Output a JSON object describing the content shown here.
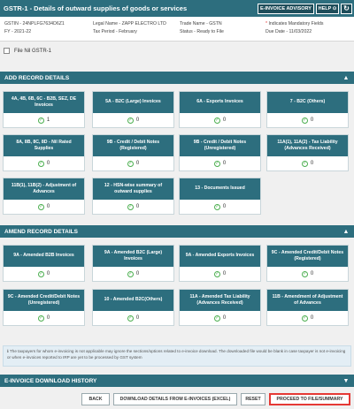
{
  "header": {
    "title": "GSTR-1 - Details of outward supplies of goods or services",
    "einvoice_label": "E-INVOICE ADVISORY",
    "help_label": "HELP ⊙",
    "refresh_label": "↻"
  },
  "info": {
    "gstin": "GSTIN - 24NPLFG7634D6Z1",
    "fy": "FY - 2021-22",
    "legal_name": "Legal Name - ZAPP ELECTRO LTD",
    "tax_period": "Tax Period - February",
    "trade_name": "Trade Name - GSTN",
    "status": "Status - Ready to File",
    "mandatory": "Indicates Mandatory Fields",
    "due_date": "Due Date - 11/03/2022"
  },
  "nil": {
    "label": "File Nil GSTR-1"
  },
  "add_section": {
    "title": "ADD RECORD DETAILS"
  },
  "add_tiles": [
    {
      "title": "4A, 4B, 6B, 6C - B2B, SEZ, DE Invoices",
      "count": "1"
    },
    {
      "title": "5A - B2C (Large) Invoices",
      "count": "0"
    },
    {
      "title": "6A - Exports Invoices",
      "count": "0"
    },
    {
      "title": "7 - B2C (Others)",
      "count": "0"
    },
    {
      "title": "8A, 8B, 8C, 8D - Nil Rated Supplies",
      "count": "0"
    },
    {
      "title": "9B - Credit / Debit Notes (Registered)",
      "count": "0"
    },
    {
      "title": "9B - Credit / Debit Notes (Unregistered)",
      "count": "0"
    },
    {
      "title": "11A(1), 11A(2) - Tax Liability (Advances Received)",
      "count": "0"
    },
    {
      "title": "11B(1), 11B(2) - Adjustment of Advances",
      "count": "0"
    },
    {
      "title": "12 - HSN-wise summary of outward supplies",
      "count": "0"
    },
    {
      "title": "13 - Documents Issued",
      "count": "0"
    }
  ],
  "amend_section": {
    "title": "AMEND RECORD DETAILS"
  },
  "amend_tiles": [
    {
      "title": "9A - Amended B2B Invoices",
      "count": "0"
    },
    {
      "title": "9A - Amended B2C (Large) Invoices",
      "count": "0"
    },
    {
      "title": "9A - Amended Exports Invoices",
      "count": "0"
    },
    {
      "title": "9C - Amended Credit/Debit Notes (Registered)",
      "count": "0"
    },
    {
      "title": "9C - Amended Credit/Debit Notes (Unregistered)",
      "count": "0"
    },
    {
      "title": "10 - Amended B2C(Others)",
      "count": "0"
    },
    {
      "title": "11A - Amended Tax Liability (Advances Received)",
      "count": "0"
    },
    {
      "title": "11B - Amendment of Adjustment of Advances",
      "count": "0"
    }
  ],
  "note": {
    "text": "The taxpayers for whom e-invoicing is not applicable may ignore the sections/options related to e-invoice download. The downloaded file would be blank in case taxpayer is not e-invoicing or when e-invoices reported to IRP are yet to be processed by GST system"
  },
  "einvoice_section": {
    "title": "E-INVOICE DOWNLOAD HISTORY"
  },
  "buttons": {
    "back": "BACK",
    "download": "DOWNLOAD DETAILS FROM E-INVOICES (EXCEL)",
    "reset": "RESET",
    "proceed": "PROCEED TO FILE/SUMMARY"
  }
}
